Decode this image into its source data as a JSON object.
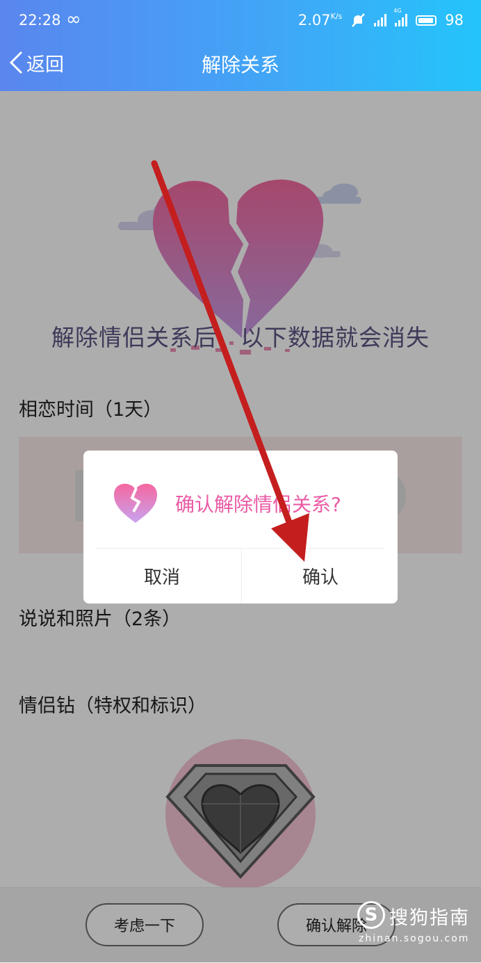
{
  "status_bar": {
    "time": "22:28",
    "link_symbol": "∞",
    "speed": "2.07",
    "speed_unit": "K/s",
    "network": "4G",
    "battery": "98"
  },
  "nav": {
    "back_label": "返回",
    "title": "解除关系"
  },
  "hero": {
    "message": "解除情侣关系后，以下数据就会消失"
  },
  "sections": {
    "days": "相恋时间（1天）",
    "posts": "说说和照片（2条）",
    "diamond": "情侣钻（特权和标识）"
  },
  "bottom": {
    "think_label": "考虑一下",
    "confirm_label": "确认解除"
  },
  "dialog": {
    "message": "确认解除情侣关系?",
    "cancel_label": "取消",
    "ok_label": "确认"
  },
  "watermark": {
    "logo": "S",
    "name": "搜狗指南",
    "url": "zhinan.sogou.com"
  },
  "colors": {
    "header_start": "#5a86ee",
    "header_end": "#24c4fb",
    "dialog_accent": "#ea5ba6",
    "annotation_arrow": "#c41e1e"
  }
}
